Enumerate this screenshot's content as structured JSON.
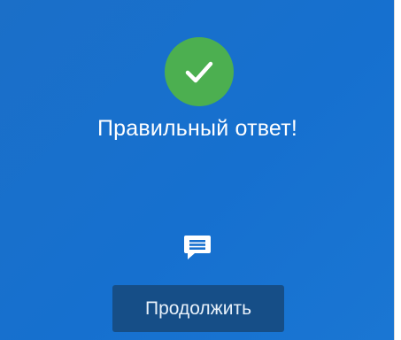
{
  "result": {
    "message": "Правильный ответ!",
    "icon": "checkmark-icon",
    "status_color": "#4caf50"
  },
  "comment": {
    "icon": "comment-icon"
  },
  "actions": {
    "continue_label": "Продолжить"
  },
  "theme": {
    "background": "#1670cf",
    "button_background": "#164e87"
  }
}
